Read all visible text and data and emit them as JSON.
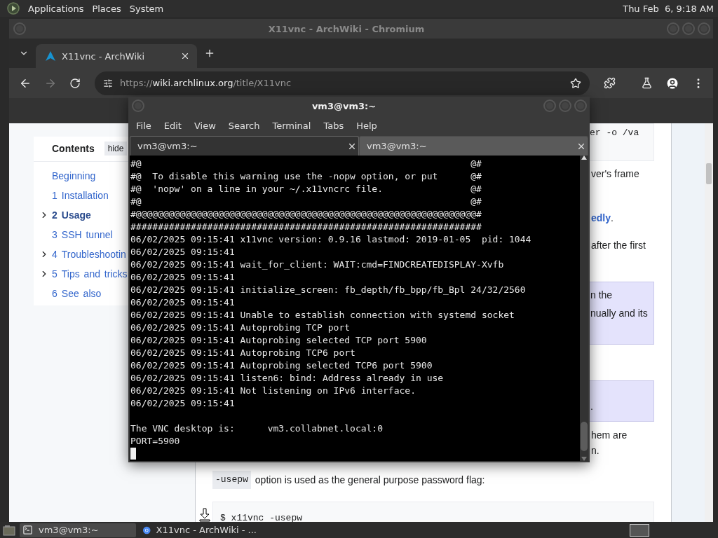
{
  "top_panel": {
    "menus": [
      "Applications",
      "Places",
      "System"
    ],
    "clock": "Thu Feb  6, 9:18 AM"
  },
  "browser": {
    "title": "X11vnc - ArchWiki - Chromium",
    "tabs": [
      {
        "label": "X11vnc - ArchWiki",
        "selected": true
      }
    ],
    "forward_disabled": true,
    "url": {
      "scheme": "https://",
      "host": "wiki.archlinux.org",
      "path": "/title/X11vnc"
    }
  },
  "page": {
    "toc": {
      "title": "Contents",
      "hide_label": "hide",
      "items": [
        {
          "label": "Beginning",
          "expandable": false,
          "selected": false
        },
        {
          "number": "1",
          "label": "Installation",
          "expandable": false,
          "selected": false
        },
        {
          "number": "2",
          "label": "Usage",
          "expandable": true,
          "selected": true
        },
        {
          "number": "3",
          "label": "SSH tunnel",
          "expandable": false,
          "selected": false
        },
        {
          "number": "4",
          "label": "Troubleshootin",
          "expandable": true,
          "selected": false
        },
        {
          "number": "5",
          "label": "Tips and tricks",
          "expandable": true,
          "selected": false
        },
        {
          "number": "6",
          "label": "See also",
          "expandable": false,
          "selected": false
        }
      ]
    },
    "article": [
      {
        "kind": "code",
        "lines": [
          "er -o /va"
        ]
      },
      {
        "kind": "text",
        "lines": [
          "ver's frame"
        ]
      },
      {
        "kind": "text",
        "lines": [
          "**edly**."
        ]
      },
      {
        "kind": "text",
        "lines": [
          "after the first"
        ]
      },
      {
        "kind": "note",
        "lines": [
          "n the",
          "nually and its"
        ]
      },
      {
        "kind": "note",
        "lines": [
          "."
        ]
      },
      {
        "kind": "text",
        "lines": [
          "hem are",
          "n."
        ]
      },
      {
        "kind": "flag",
        "code": "-usepw",
        "text": "option is used as the general purpose password flag:"
      },
      {
        "kind": "code",
        "lines": [
          "$ x11vnc -usepw"
        ]
      }
    ]
  },
  "terminal": {
    "title": "vm3@vm3:~",
    "menus": [
      "File",
      "Edit",
      "View",
      "Search",
      "Terminal",
      "Tabs",
      "Help"
    ],
    "tabs": [
      {
        "label": "vm3@vm3:~",
        "selected": true
      },
      {
        "label": "vm3@vm3:~",
        "selected": false
      }
    ],
    "output_blocks": [
      {
        "lines": [
          "#@                                                            @#",
          "#@  To disable this warning use the -nopw option, or put      @#",
          "#@  'nopw' on a line in your ~/.x11vncrc file.                @#",
          "#@                                                            @#",
          "#@@@@@@@@@@@@@@@@@@@@@@@@@@@@@@@@@@@@@@@@@@@@@@@@@@@@@@@@@@@@@@#",
          "################################################################",
          "06/02/2025 09:15:41 x11vnc version: 0.9.16 lastmod: 2019-01-05  pid: 1044",
          "06/02/2025 09:15:41",
          "06/02/2025 09:15:41 wait_for_client: WAIT:cmd=FINDCREATEDISPLAY-Xvfb",
          "06/02/2025 09:15:41",
          "06/02/2025 09:15:41 initialize_screen: fb_depth/fb_bpp/fb_Bpl 24/32/2560",
          "06/02/2025 09:15:41",
          "06/02/2025 09:15:41 Unable to establish connection with systemd socket",
          "06/02/2025 09:15:41 Autoprobing TCP port",
          "06/02/2025 09:15:41 Autoprobing selected TCP port 5900",
          "06/02/2025 09:15:41 Autoprobing TCP6 port",
          "06/02/2025 09:15:41 Autoprobing selected TCP6 port 5900",
          "06/02/2025 09:15:41 listen6: bind: Address already in use",
          "06/02/2025 09:15:41 Not listening on IPv6 interface.",
          "06/02/2025 09:15:41"
        ]
      },
      {
        "lines": [
          "The VNC desktop is:      vm3.collabnet.local:0",
          "PORT=5900"
        ]
      }
    ],
    "cursor": true
  },
  "taskbar": {
    "tasks": [
      {
        "kind": "terminal",
        "label": "vm3@vm3:~",
        "selected": true
      },
      {
        "kind": "browser",
        "label": "X11vnc - ArchWiki - ...",
        "selected": false
      }
    ]
  }
}
